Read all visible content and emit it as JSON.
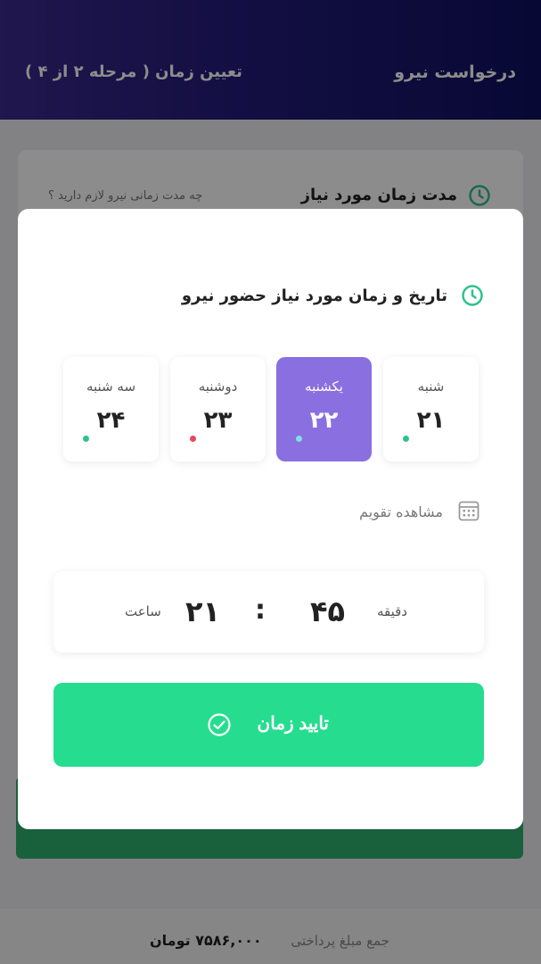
{
  "header": {
    "title": "درخواست نیرو",
    "step": "تعیین زمان ( مرحله ۲ از ۴ )"
  },
  "background_section": {
    "title": "مدت زمان مورد نیاز",
    "subtitle": "چه مدت زمانی نیرو لازم دارید ؟"
  },
  "footer": {
    "label": "جمع مبلغ پرداختی",
    "amount": "۷۵۸۶,۰۰۰ تومان"
  },
  "modal": {
    "title": "تاریخ و زمان مورد نیاز حضور نیرو",
    "days": [
      {
        "name": "شنبه",
        "number": "۲۱",
        "selected": false,
        "dot_color": "#2fc28a"
      },
      {
        "name": "یکشنبه",
        "number": "۲۲",
        "selected": true,
        "dot_color": "#7fe0e8"
      },
      {
        "name": "دوشنبه",
        "number": "۲۳",
        "selected": false,
        "dot_color": "#e8485a"
      },
      {
        "name": "سه شنبه",
        "number": "۲۴",
        "selected": false,
        "dot_color": "#2fc28a"
      }
    ],
    "calendar_link": "مشاهده تقویم",
    "time": {
      "minute_label": "دقیقه",
      "minute_value": "۴۵",
      "separator": ":",
      "hour_value": "۲۱",
      "hour_label": "ساعت"
    },
    "confirm_label": "تایید زمان"
  },
  "colors": {
    "accent_green": "#2fc28a",
    "selected_purple": "#8a6fe0",
    "button_green": "#26dd8f"
  }
}
